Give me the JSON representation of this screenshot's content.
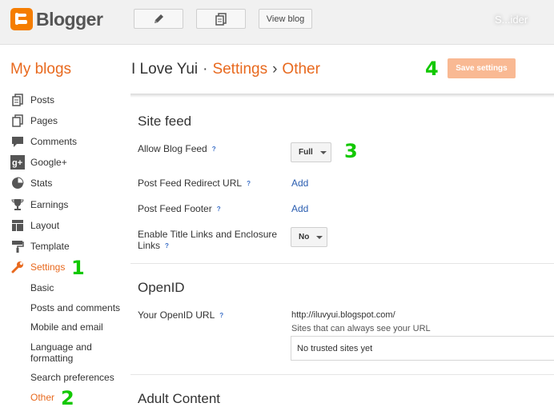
{
  "app": {
    "logo_text": "Blogger",
    "view_blog_label": "View blog",
    "user_name": "S...ider"
  },
  "header": {
    "my_blogs": "My blogs",
    "blog_name": "I Love Yui",
    "sep1": "·",
    "crumb_settings": "Settings",
    "sep2": "›",
    "crumb_other": "Other",
    "save_label": "Save settings"
  },
  "steps": {
    "s1": "1",
    "s2": "2",
    "s3": "3",
    "s4": "4"
  },
  "sidebar": {
    "items": [
      {
        "label": "Posts",
        "icon": "posts-icon"
      },
      {
        "label": "Pages",
        "icon": "pages-icon"
      },
      {
        "label": "Comments",
        "icon": "comments-icon"
      },
      {
        "label": "Google+",
        "icon": "google-plus-icon"
      },
      {
        "label": "Stats",
        "icon": "stats-icon"
      },
      {
        "label": "Earnings",
        "icon": "earnings-icon"
      },
      {
        "label": "Layout",
        "icon": "layout-icon"
      },
      {
        "label": "Template",
        "icon": "template-icon"
      },
      {
        "label": "Settings",
        "icon": "wrench-icon"
      }
    ],
    "sub_items": [
      {
        "label": "Basic"
      },
      {
        "label": "Posts and comments"
      },
      {
        "label": "Mobile and email"
      },
      {
        "label": "Language and formatting"
      },
      {
        "label": "Search preferences"
      },
      {
        "label": "Other"
      }
    ]
  },
  "site_feed": {
    "title": "Site feed",
    "allow_label": "Allow Blog Feed",
    "allow_value": "Full",
    "redirect_label": "Post Feed Redirect URL",
    "redirect_action": "Add",
    "footer_label": "Post Feed Footer",
    "footer_action": "Add",
    "enclosure_label_1": "Enable Title Links and Enclosure",
    "enclosure_label_2": "Links",
    "enclosure_value": "No",
    "help": "?"
  },
  "openid": {
    "title": "OpenID",
    "url_label": "Your OpenID URL",
    "url_value": "http://iluvyui.blogspot.com/",
    "note": "Sites that can always see your URL",
    "trusted": "No trusted sites yet"
  },
  "adult": {
    "title": "Adult Content"
  },
  "colors": {
    "accent": "#e8691e",
    "link": "#2a5db0",
    "step": "#12c800",
    "save_bg": "#f9b993"
  }
}
